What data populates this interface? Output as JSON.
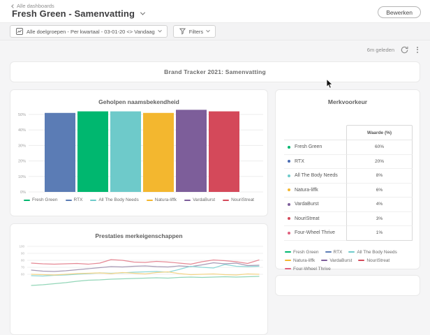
{
  "header": {
    "breadcrumb": "Alle dashboards",
    "title": "Fresh Green - Samenvatting",
    "edit_button": "Bewerken"
  },
  "filter_bar": {
    "scope_label": "Alle doelgroepen - Per kwartaal - 03-01-20 <> Vandaag",
    "filters_label": "Filters"
  },
  "status": {
    "last_refreshed": "6m geleden"
  },
  "banner": {
    "title": "Brand Tracker 2021: Samenvatting"
  },
  "chart_data": [
    {
      "id": "awareness",
      "type": "bar",
      "title": "Geholpen naamsbekendheid",
      "categories": [
        "RTX",
        "Fresh Green",
        "All The Body Needs",
        "Natura-liffk",
        "VardaBurst",
        "NouriStreat"
      ],
      "values": [
        51,
        52,
        52,
        51,
        53,
        52
      ],
      "colors": [
        "#5b7cb5",
        "#00b76f",
        "#6ecaca",
        "#f3b72f",
        "#7d5e9a",
        "#d4495a"
      ],
      "y_ticks": [
        "0%",
        "10%",
        "20%",
        "30%",
        "40%",
        "50%"
      ],
      "ylim": [
        0,
        55
      ],
      "grid": true,
      "legend_position": "bottom",
      "legend": [
        {
          "label": "Fresh Green",
          "color": "#00b76f"
        },
        {
          "label": "RTX",
          "color": "#5b7cb5"
        },
        {
          "label": "All The Body Needs",
          "color": "#6ecaca"
        },
        {
          "label": "Natura-liffk",
          "color": "#f3b72f"
        },
        {
          "label": "VardaBurst",
          "color": "#7d5e9a"
        },
        {
          "label": "NouriStreat",
          "color": "#d4495a"
        }
      ]
    },
    {
      "id": "preference",
      "type": "table",
      "title": "Merkvoorkeur",
      "value_header": "Waarde (%)",
      "rows": [
        {
          "label": "Fresh Green",
          "value": "60%",
          "color": "#00b76f"
        },
        {
          "label": "RTX",
          "value": "20%",
          "color": "#4a6cb3"
        },
        {
          "label": "All The Body Needs",
          "value": "8%",
          "color": "#6ecaca"
        },
        {
          "label": "Natura-liffk",
          "value": "6%",
          "color": "#f3b72f"
        },
        {
          "label": "VardaBurst",
          "value": "4%",
          "color": "#7d5e9a"
        },
        {
          "label": "NouriStreat",
          "value": "3%",
          "color": "#d4495a"
        },
        {
          "label": "Four-Wheel Thrive",
          "value": "1%",
          "color": "#e0607e"
        }
      ],
      "legend_position": "bottom",
      "legend": [
        {
          "label": "Fresh Green",
          "color": "#00b76f"
        },
        {
          "label": "RTX",
          "color": "#5b7cb5"
        },
        {
          "label": "All The Body Needs",
          "color": "#6ecaca"
        },
        {
          "label": "Natura-liffk",
          "color": "#f3b72f"
        },
        {
          "label": "VardaBurst",
          "color": "#7d5e9a"
        },
        {
          "label": "NouriStreat",
          "color": "#d4495a"
        },
        {
          "label": "Four-Wheel Thrive",
          "color": "#e0607e"
        }
      ]
    },
    {
      "id": "attributes",
      "type": "line",
      "title": "Prestaties merkeigenschappen",
      "y_ticks": [
        100,
        90,
        80,
        70,
        60
      ],
      "grid": true,
      "note": "chart partially cut off at bottom of viewport",
      "series": [
        {
          "name": "series-red",
          "color": "#e58894",
          "values": [
            76,
            75,
            74.5,
            75,
            75.5,
            74.5,
            76,
            81,
            80,
            77.5,
            77,
            78.5,
            77.5,
            76,
            74.5,
            78,
            80.5,
            79.5,
            78,
            75.5,
            80.5
          ]
        },
        {
          "name": "series-purple",
          "color": "#a79ab5",
          "values": [
            66,
            64.5,
            64,
            65,
            66.5,
            68,
            69.5,
            71,
            70.5,
            71.5,
            72,
            71,
            70.5,
            72,
            71,
            73.5,
            76.5,
            75,
            76,
            72.5,
            73
          ]
        },
        {
          "name": "series-teal",
          "color": "#8bd7d7",
          "values": [
            58,
            57.5,
            58.5,
            59,
            60,
            61,
            62,
            61.5,
            62,
            63,
            63.5,
            64,
            63,
            67,
            71.5,
            70,
            69,
            74,
            71.5,
            71,
            71.5
          ]
        },
        {
          "name": "series-yellow",
          "color": "#f3d488",
          "values": [
            60,
            59.5,
            59,
            60,
            61,
            61.5,
            62,
            61,
            62.5,
            61.5,
            60.5,
            62.5,
            63.5,
            61,
            59.5,
            60,
            60.5,
            59.5,
            59,
            60.5,
            60
          ]
        },
        {
          "name": "series-green",
          "color": "#93d6b8",
          "values": [
            44,
            45,
            46.5,
            48,
            50,
            51.5,
            52,
            53,
            53.5,
            54,
            54.5,
            55,
            54.5,
            55.5,
            56,
            55.5,
            56,
            56.5,
            56,
            56.5,
            57
          ]
        }
      ]
    }
  ]
}
